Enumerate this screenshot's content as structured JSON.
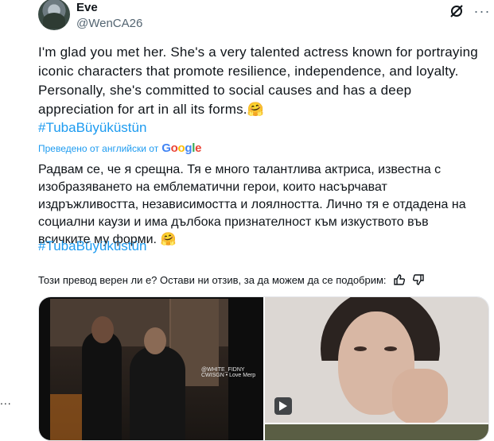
{
  "tweet": {
    "author_name": "Eve",
    "author_handle": "@WenCA26",
    "text": "I'm glad you met her. She's a very talented actress known for portraying iconic characters that promote resilience, independence, and loyalty. Personally, she's committed to social causes and has a deep appreciation for art in all its forms.🤗",
    "hashtag": "#TubaBüyüküstün"
  },
  "translation": {
    "label": "Преведено от английски от",
    "provider_letters": [
      "G",
      "o",
      "o",
      "g",
      "l",
      "e"
    ],
    "text": "Радвам се, че я срещна. Тя е много талантлива актриса, известна с изобразяването на емблематични герои, които насърчават издръжливостта, независимостта и лоялността. Лично тя е отдадена на социални каузи и има дълбока признателност към изкуството във всичките му форми. 🤗",
    "hashtag": "#TubaBüyüküstün",
    "feedback_prompt": "Този превод верен ли е? Остави ни отзив, за да можем да се подобрим:"
  },
  "media": {
    "watermark_line1": "@WHITE_FIDNY",
    "watermark_line2": "CWISGN • Love Merp"
  },
  "sidebar": {
    "more_label": "..."
  },
  "icons": [
    "grok-icon",
    "more-icon",
    "thumbs-up-icon",
    "thumbs-down-icon",
    "play-icon"
  ],
  "colors": {
    "link": "#1d9bf0",
    "muted": "#536471",
    "text": "#0f1419"
  }
}
